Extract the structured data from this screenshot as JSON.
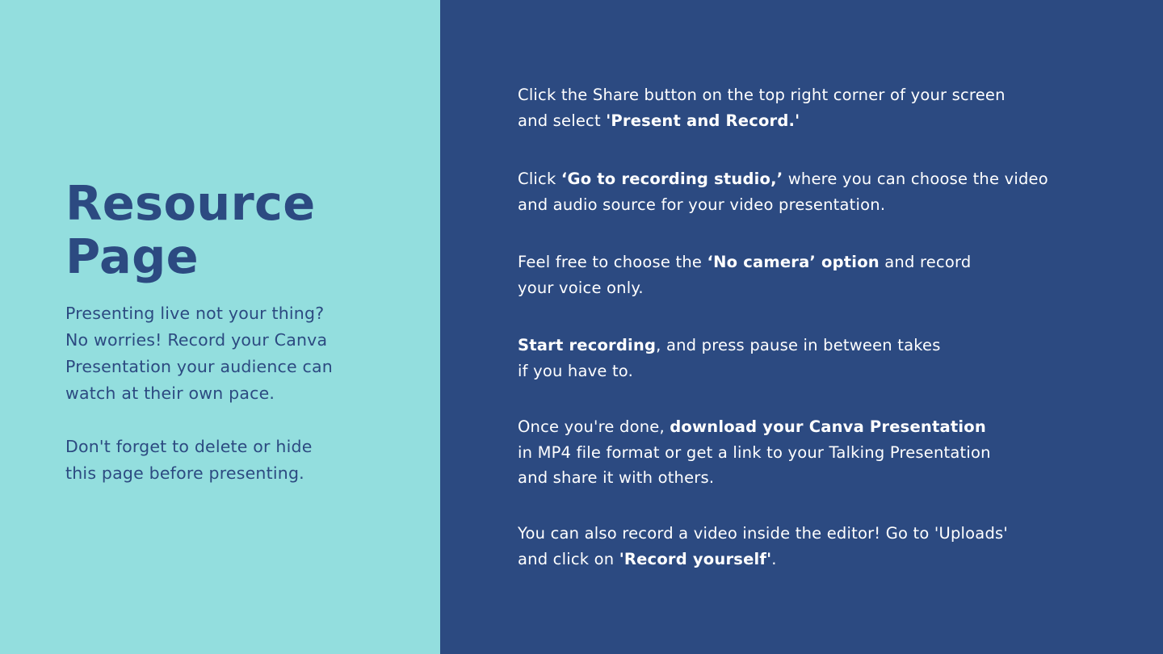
{
  "colors": {
    "left_background": "#93dede",
    "right_background": "#2c4a81",
    "title_text": "#2c4a81",
    "body_text_right": "#ffffff"
  },
  "left": {
    "title_line_1": "Resource",
    "title_line_2": "Page",
    "intro_lines": [
      "Presenting live not your thing?",
      "No worries! Record your Canva",
      "Presentation your audience can",
      "watch at their own pace."
    ],
    "reminder_lines": [
      "Don't forget to delete or hide",
      "this page before presenting."
    ]
  },
  "steps": [
    {
      "line_1": "Click the Share button on the top right corner of your screen",
      "line_2_prefix": "and select ",
      "line_2_bold": "'Present and Record.'"
    },
    {
      "line_1_prefix": "Click ",
      "line_1_bold": "‘Go to recording studio,’",
      "line_1_suffix": " where you can choose the video",
      "line_2": "and audio source for your video presentation."
    },
    {
      "line_1_prefix": "Feel free to choose the ",
      "line_1_bold": "‘No camera’ option",
      "line_1_suffix": " and record",
      "line_2": "your voice only."
    },
    {
      "line_1_bold": "Start recording",
      "line_1_suffix": ", and press pause in between takes",
      "line_2": "if you have to."
    },
    {
      "line_1_prefix": "Once you're done, ",
      "line_1_bold": "download your Canva Presentation",
      "line_2": "in MP4 file format or get a link to your Talking Presentation",
      "line_3": "and share it with others."
    },
    {
      "line_1": "You can also record a video inside the editor! Go to 'Uploads'",
      "line_2_prefix": "and click on ",
      "line_2_bold": "'Record yourself'",
      "line_2_suffix": "."
    }
  ]
}
